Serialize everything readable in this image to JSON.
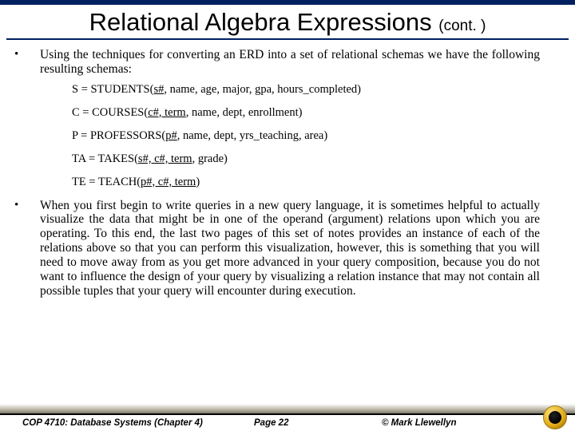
{
  "title": {
    "main": "Relational Algebra Expressions ",
    "cont": "(cont. )"
  },
  "bullets": {
    "b1": "Using the techniques for converting an ERD into a set of relational schemas we have the following resulting schemas:",
    "b2": "When you first begin to write queries in a new query language, it is sometimes helpful to actually visualize the data that might be in one of the operand (argument) relations upon which you are operating.  To this end, the last two pages of this set of notes provides an instance of each of the relations above so that you can perform this visualization, however, this is something that you will need to move away from as you get more advanced in your query composition, because you do not want to influence the design of your query by visualizing a relation instance that may not contain all possible tuples that your query will encounter during execution."
  },
  "schemas": {
    "s1": {
      "pre": "S = STUDENTS(",
      "key": "s#",
      "rest": ", name, age, major, gpa, hours_completed)"
    },
    "s2": {
      "pre": "C = COURSES(",
      "key": "c#, term",
      "rest": ", name, dept, enrollment)"
    },
    "s3": {
      "pre": "P = PROFESSORS(",
      "key": "p#",
      "rest": ", name, dept, yrs_teaching, area)"
    },
    "s4": {
      "pre": "TA = TAKES(",
      "key": "s#, c#, term",
      "rest": ", grade)"
    },
    "s5": {
      "pre": "TE = TEACH(",
      "key": "p#, c#, term",
      "rest": ")"
    }
  },
  "footer": {
    "course": "COP 4710: Database Systems  (Chapter 4)",
    "page": "Page 22",
    "copyright": "© Mark Llewellyn"
  }
}
